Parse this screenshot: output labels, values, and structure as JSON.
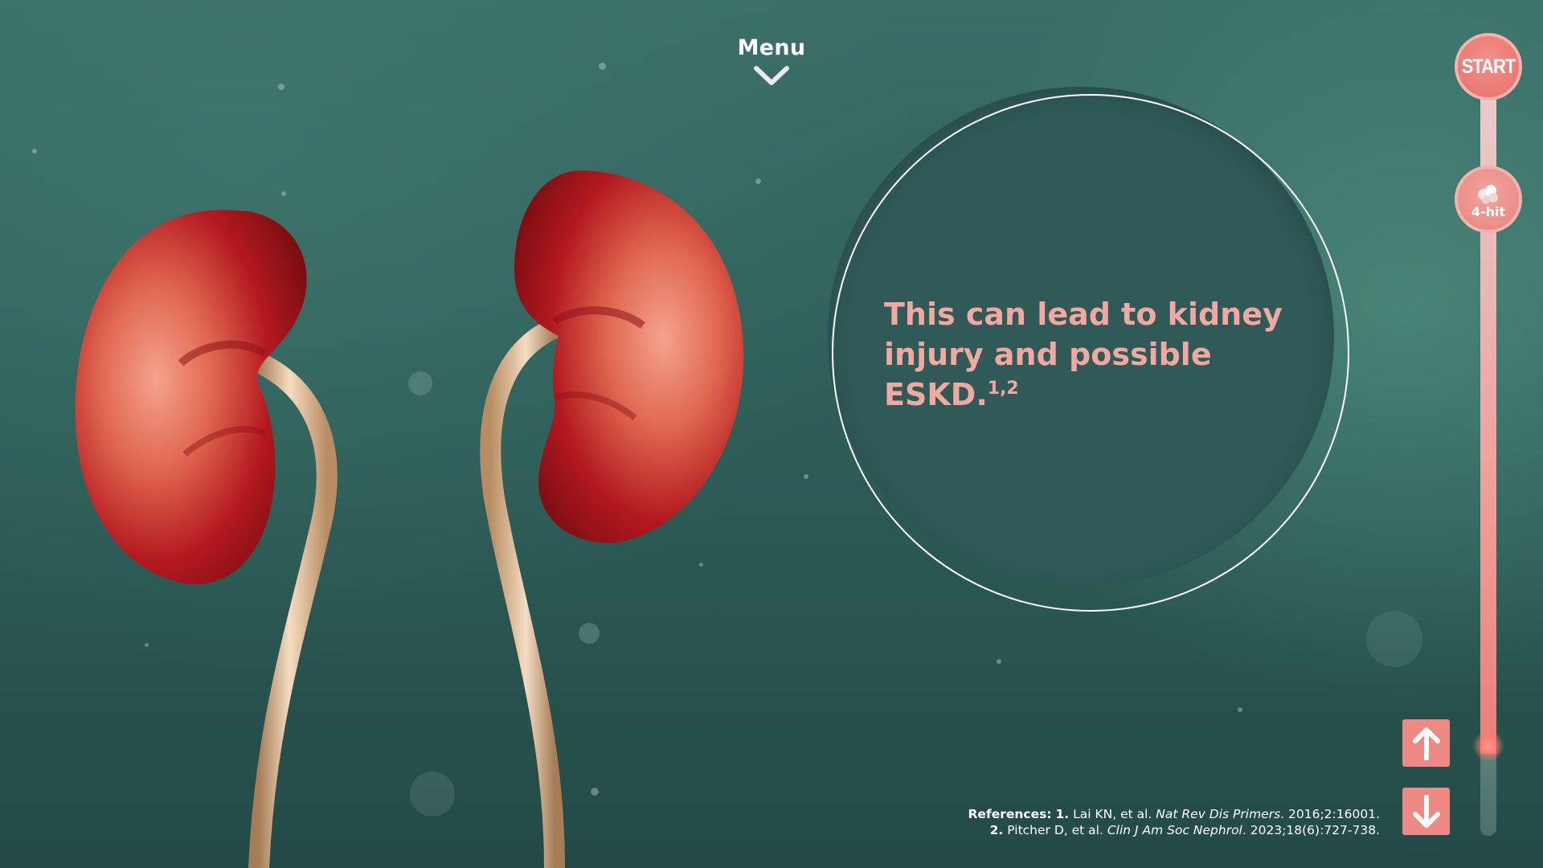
{
  "menu": {
    "label": "Menu",
    "icon": "chevron-down-icon"
  },
  "info": {
    "line1": "This can lead to kidney",
    "line2": "injury and possible ESKD.",
    "superscript": "1,2"
  },
  "progress": {
    "start_label": "START",
    "step_label": "4-hit",
    "step_icon": "molecule-cluster-icon",
    "level": 0.88
  },
  "nav": {
    "up_icon": "arrow-up-icon",
    "down_icon": "arrow-down-icon"
  },
  "references": {
    "heading": "References:",
    "ref1_num": "1.",
    "ref1_authors": "Lai KN, et al.",
    "ref1_journal": "Nat Rev Dis Primers",
    "ref1_detail": ". 2016;2:16001.",
    "ref2_num": "2.",
    "ref2_authors": "Pitcher D, et al.",
    "ref2_journal": "Clin J Am Soc Nephrol",
    "ref2_detail": ". 2023;18(6):727-738."
  },
  "colors": {
    "background_top": "#3a6e67",
    "background_bottom": "#234a47",
    "accent_pink": "#ee8a84",
    "text_pink": "#f0a8a0",
    "kidney_red": "#b3191f",
    "ureter_tan": "#d9b189"
  }
}
